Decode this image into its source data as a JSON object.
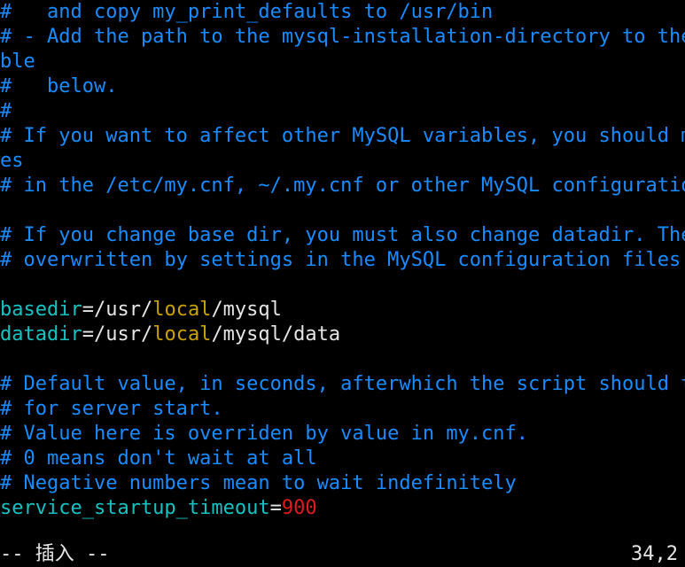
{
  "lines": [
    "#   and copy my_print_defaults to /usr/bin",
    "# - Add the path to the mysql-installation-directory to the",
    "ble",
    "#   below.",
    "#",
    "# If you want to affect other MySQL variables, you should ma",
    "es",
    "# in the /etc/my.cnf, ~/.my.cnf or other MySQL configuration",
    "",
    "# If you change base dir, you must also change datadir. Thes",
    "# overwritten by settings in the MySQL configuration files.",
    "",
    "# Default value, in seconds, afterwhich the script should ti",
    "# for server start.",
    "# Value here is overriden by value in my.cnf.",
    "# 0 means don't wait at all",
    "# Negative numbers mean to wait indefinitely"
  ],
  "basedir": {
    "key": "basedir",
    "eq": "=",
    "p1": "/usr/",
    "p2": "local",
    "p3": "/mysql"
  },
  "datadir": {
    "key": "datadir",
    "eq": "=",
    "p1": "/usr/",
    "p2": "local",
    "p3": "/mysql/data"
  },
  "timeout": {
    "key": "service_startup_timeout",
    "eq": "=",
    "value": "900"
  },
  "status": {
    "mode": "-- 插入 --",
    "position": "34,2"
  },
  "colors": {
    "background": "#000000",
    "comment": "#1a8cff",
    "key": "#13c3c3",
    "text": "#e6e6e6",
    "keyword": "#c8a000",
    "number": "#e01b1b"
  }
}
